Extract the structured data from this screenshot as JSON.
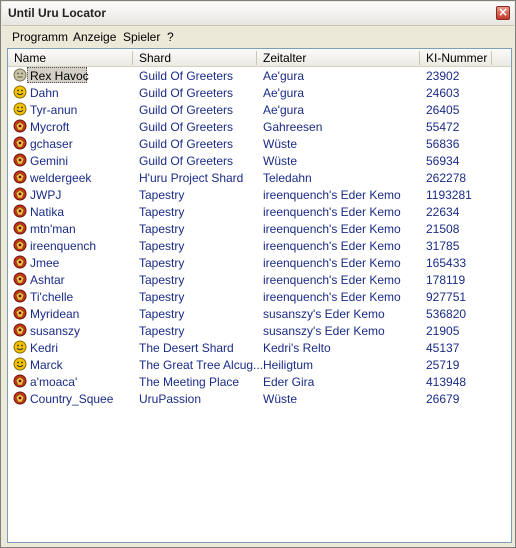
{
  "window": {
    "title": "Until Uru Locator"
  },
  "menu": [
    "Programm",
    "Anzeige",
    "Spieler",
    "?"
  ],
  "columns": [
    "Name",
    "Shard",
    "Zeitalter",
    "KI-Nummer"
  ],
  "colors": {
    "title_close": "#c0392b",
    "text": "#1a2b86",
    "selected_bg": "#d4d0c8"
  },
  "rows": [
    {
      "name": "Rex Havoc",
      "shard": "Guild Of Greeters",
      "age": "Ae'gura",
      "ki": "23902",
      "icon": "neutral-face-icon",
      "selected": true
    },
    {
      "name": "Dahn",
      "shard": "Guild Of Greeters",
      "age": "Ae'gura",
      "ki": "24603",
      "icon": "smiley-icon"
    },
    {
      "name": "Tyr-anun",
      "shard": "Guild Of Greeters",
      "age": "Ae'gura",
      "ki": "26405",
      "icon": "smiley-icon"
    },
    {
      "name": "Mycroft",
      "shard": "Guild Of Greeters",
      "age": "Gahreesen",
      "ki": "55472",
      "icon": "player-relto-icon"
    },
    {
      "name": "gchaser",
      "shard": "Guild Of Greeters",
      "age": "Wüste",
      "ki": "56836",
      "icon": "player-relto-icon"
    },
    {
      "name": "Gemini",
      "shard": "Guild Of Greeters",
      "age": "Wüste",
      "ki": "56934",
      "icon": "player-relto-icon"
    },
    {
      "name": "weldergeek",
      "shard": "H'uru Project Shard",
      "age": "Teledahn",
      "ki": "262278",
      "icon": "player-relto-icon"
    },
    {
      "name": "JWPJ",
      "shard": "Tapestry",
      "age": "ireenquench's Eder Kemo",
      "ki": "1193281",
      "icon": "player-relto-icon"
    },
    {
      "name": "Natika",
      "shard": "Tapestry",
      "age": "ireenquench's Eder Kemo",
      "ki": "22634",
      "icon": "player-relto-icon"
    },
    {
      "name": "mtn'man",
      "shard": "Tapestry",
      "age": "ireenquench's Eder Kemo",
      "ki": "21508",
      "icon": "player-relto-icon"
    },
    {
      "name": "ireenquench",
      "shard": "Tapestry",
      "age": "ireenquench's Eder Kemo",
      "ki": "31785",
      "icon": "player-relto-icon"
    },
    {
      "name": "Jmee",
      "shard": "Tapestry",
      "age": "ireenquench's Eder Kemo",
      "ki": "165433",
      "icon": "player-relto-icon"
    },
    {
      "name": "Ashtar",
      "shard": "Tapestry",
      "age": "ireenquench's Eder Kemo",
      "ki": "178119",
      "icon": "player-relto-icon"
    },
    {
      "name": "Ti'chelle",
      "shard": "Tapestry",
      "age": "ireenquench's Eder Kemo",
      "ki": "927751",
      "icon": "player-relto-icon"
    },
    {
      "name": "Myridean",
      "shard": "Tapestry",
      "age": "susanszy's Eder Kemo",
      "ki": "536820",
      "icon": "player-relto-icon"
    },
    {
      "name": "susanszy",
      "shard": "Tapestry",
      "age": "susanszy's Eder Kemo",
      "ki": "21905",
      "icon": "player-relto-icon"
    },
    {
      "name": "Kedri",
      "shard": "The Desert Shard",
      "age": "Kedri's Relto",
      "ki": "45137",
      "icon": "smiley-icon"
    },
    {
      "name": "Marck",
      "shard": "The Great Tree Alcug...",
      "age": "Heiligtum",
      "ki": "25719",
      "icon": "smiley-icon"
    },
    {
      "name": "a'moaca'",
      "shard": "The Meeting Place",
      "age": "Eder Gira",
      "ki": "413948",
      "icon": "player-relto-icon"
    },
    {
      "name": "Country_Squee",
      "shard": "UruPassion",
      "age": "Wüste",
      "ki": "26679",
      "icon": "player-relto-icon"
    }
  ]
}
